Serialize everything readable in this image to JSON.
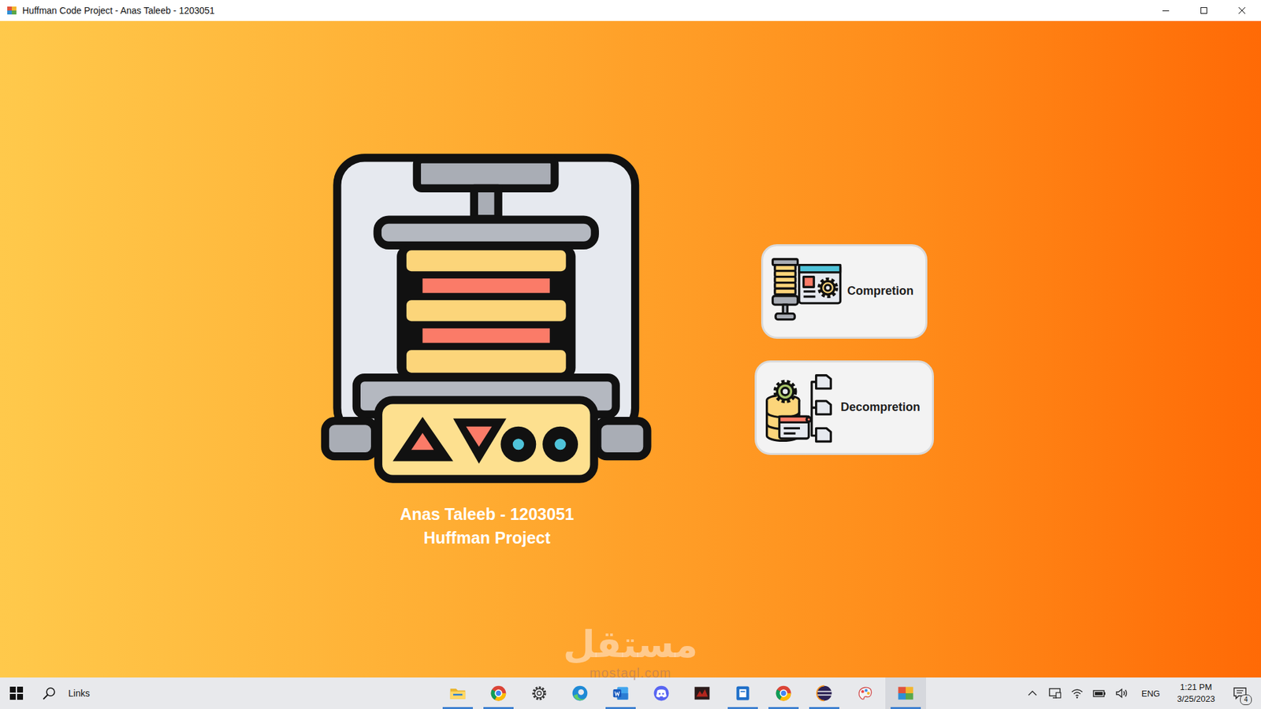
{
  "window": {
    "title": "Huffman Code Project - Anas Taleeb - 1203051"
  },
  "home": {
    "author": "Anas Taleeb - 1203051",
    "project": "Huffman Project"
  },
  "actions": [
    {
      "label": "Compretion",
      "kind": "compress"
    },
    {
      "label": "Decompretion",
      "kind": "decompress"
    }
  ],
  "watermark": {
    "text": "مستقل",
    "site": "mostaql.com"
  },
  "taskbar": {
    "search": {
      "label": "Links"
    },
    "apps": [
      {
        "kind": "explorer",
        "running": true,
        "selected": false
      },
      {
        "kind": "chrome",
        "running": true,
        "selected": false
      },
      {
        "kind": "settings",
        "running": false,
        "selected": false
      },
      {
        "kind": "edge",
        "running": false,
        "selected": false
      },
      {
        "kind": "word",
        "running": true,
        "selected": false
      },
      {
        "kind": "discord",
        "running": false,
        "selected": false
      },
      {
        "kind": "game",
        "running": false,
        "selected": false
      },
      {
        "kind": "notes",
        "running": true,
        "selected": false
      },
      {
        "kind": "chrome",
        "running": true,
        "selected": false
      },
      {
        "kind": "eclipse",
        "running": true,
        "selected": false
      },
      {
        "kind": "paint",
        "running": false,
        "selected": false
      },
      {
        "kind": "java",
        "running": true,
        "selected": true
      }
    ],
    "tray": {
      "language": "ENG",
      "time": "1:21 PM",
      "date": "3/25/2023",
      "notifications": "4"
    }
  }
}
